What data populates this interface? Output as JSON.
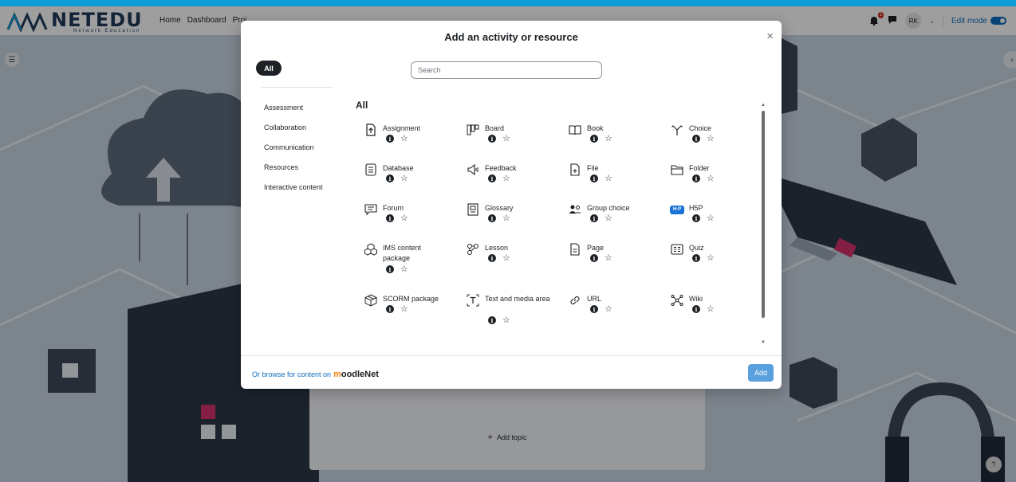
{
  "navbar": {
    "logo_text": "NETEDU",
    "logo_sub": "Network Education",
    "links": [
      "Home",
      "Dashboard",
      "Proj"
    ],
    "notification_count": "1",
    "avatar_initials": "RK",
    "edit_mode_label": "Edit mode"
  },
  "course": {
    "add_topic_label": "Add topic"
  },
  "help_label": "?",
  "modal": {
    "title": "Add an activity or resource",
    "close_icon": "×",
    "tab_all": "All",
    "search_placeholder": "Search",
    "categories": [
      "Assessment",
      "Collaboration",
      "Communication",
      "Resources",
      "Interactive content"
    ],
    "section_title": "All",
    "items": [
      {
        "name": "Assignment",
        "icon": "assignment-icon"
      },
      {
        "name": "Board",
        "icon": "board-icon"
      },
      {
        "name": "Book",
        "icon": "book-icon"
      },
      {
        "name": "Choice",
        "icon": "choice-icon"
      },
      {
        "name": "Database",
        "icon": "database-icon"
      },
      {
        "name": "Feedback",
        "icon": "feedback-icon"
      },
      {
        "name": "File",
        "icon": "file-icon"
      },
      {
        "name": "Folder",
        "icon": "folder-icon"
      },
      {
        "name": "Forum",
        "icon": "forum-icon"
      },
      {
        "name": "Glossary",
        "icon": "glossary-icon"
      },
      {
        "name": "Group choice",
        "icon": "group-choice-icon"
      },
      {
        "name": "H5P",
        "icon": "h5p-icon"
      },
      {
        "name": "IMS content package",
        "icon": "ims-package-icon"
      },
      {
        "name": "Lesson",
        "icon": "lesson-icon"
      },
      {
        "name": "Page",
        "icon": "page-icon"
      },
      {
        "name": "Quiz",
        "icon": "quiz-icon"
      },
      {
        "name": "SCORM package",
        "icon": "scorm-icon"
      },
      {
        "name": "Text and media area",
        "icon": "text-media-icon"
      },
      {
        "name": "URL",
        "icon": "url-icon"
      },
      {
        "name": "Wiki",
        "icon": "wiki-icon"
      }
    ],
    "browse_text": "Or browse for content on",
    "moodlenet_brand": "moodleNet",
    "add_button": "Add"
  },
  "colors": {
    "accent": "#0f6cbf",
    "dark": "#1d2125",
    "add_button": "#5a9fde",
    "edge": "#0ea5e9"
  }
}
